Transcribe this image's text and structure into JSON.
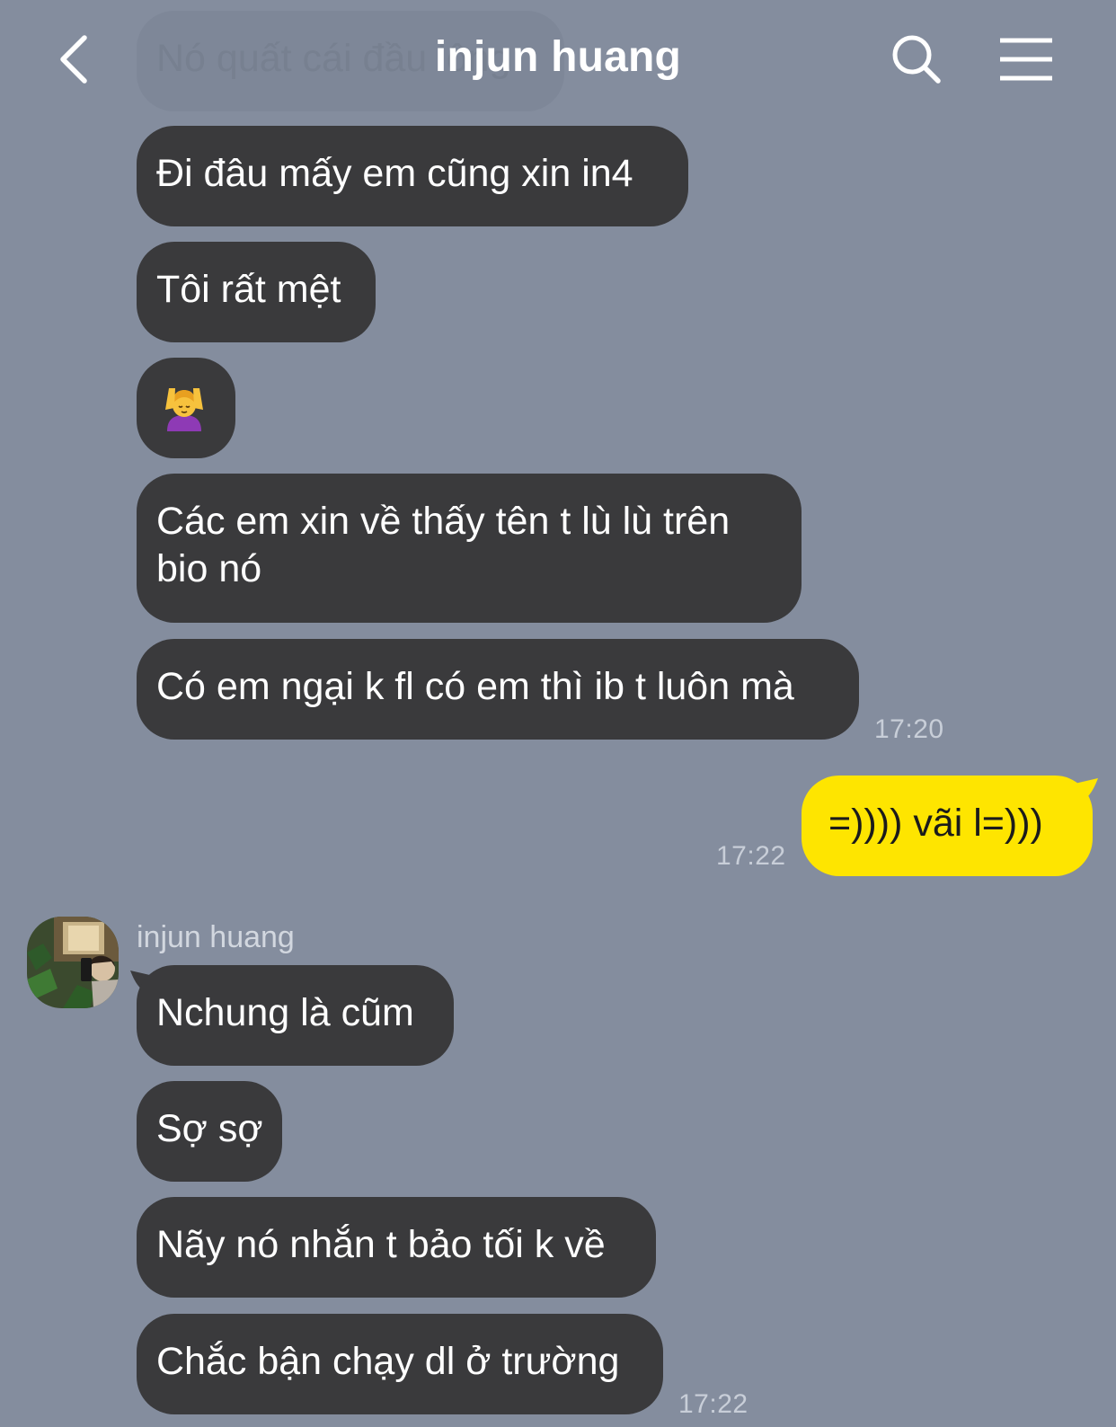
{
  "header": {
    "title": "injun huang",
    "back_icon": "chevron-left-icon",
    "search_icon": "search-icon",
    "menu_icon": "menu-icon"
  },
  "messages": {
    "faded_preview": "Nó quất cái đầu lông",
    "m1": "Đi đâu mấy em cũng xin in4",
    "m2": "Tôi rất mệt",
    "m3_emoji": "🙆‍♀️",
    "m4": "Các em xin về thấy tên t lù lù trên bio nó",
    "m5": "Có em ngại k fl có em thì ib t luôn mà",
    "time1": "17:20",
    "mine1": "=)))) vãi l=)))",
    "time2": "17:22",
    "sender": "injun huang",
    "m6": "Nchung là cũm",
    "m7": "Sợ sợ",
    "m8": "Nãy nó nhắn t bảo tối k về",
    "m9": "Chắc bận chạy dl ở trường",
    "time3": "17:22"
  },
  "colors": {
    "background": "#848d9e",
    "incoming_bubble": "#3a3a3c",
    "outgoing_bubble": "#fee500"
  }
}
